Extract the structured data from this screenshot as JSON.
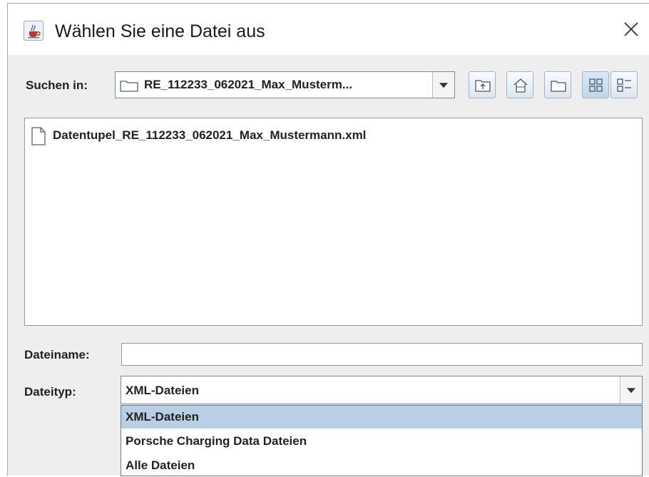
{
  "window": {
    "title": "Wählen Sie eine Datei aus",
    "app_icon": "java-cup-icon",
    "close_icon": "close-icon"
  },
  "look_in": {
    "label": "Suchen in:",
    "value": "RE_112233_062021_Max_Musterm...",
    "folder_icon": "folder-icon"
  },
  "toolbar": {
    "buttons": [
      {
        "name": "up-one-level-button",
        "icon": "folder-up-icon"
      },
      {
        "name": "home-button",
        "icon": "home-icon"
      },
      {
        "name": "new-folder-button",
        "icon": "new-folder-icon"
      },
      {
        "name": "list-view-button",
        "icon": "list-view-icon",
        "selected": true
      },
      {
        "name": "details-view-button",
        "icon": "details-view-icon"
      }
    ]
  },
  "files": [
    {
      "name": "Datentupel_RE_112233_062021_Max_Mustermann.xml",
      "icon": "file-icon"
    }
  ],
  "filename": {
    "label": "Dateiname:",
    "value": ""
  },
  "filetype": {
    "label": "Dateityp:",
    "selected": "XML-Dateien",
    "options": [
      "XML-Dateien",
      "Porsche Charging Data Dateien",
      "Alle Dateien"
    ]
  },
  "colors": {
    "dialog_bg": "#eeeeee",
    "selection": "#b8cfe5",
    "border": "#8e9aa6"
  }
}
